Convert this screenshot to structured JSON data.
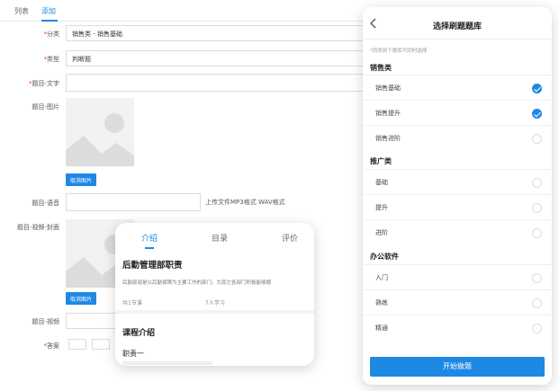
{
  "admin": {
    "tabs": [
      {
        "label": "列表"
      },
      {
        "label": "添加"
      }
    ],
    "fields": {
      "category": {
        "label": "分类",
        "value": "销售类 - 销售基础"
      },
      "type": {
        "label": "类型",
        "value": "判断题"
      },
      "text": {
        "label": "题目-文字",
        "value": ""
      },
      "image": {
        "label": "题目-图片",
        "button": "取消图片"
      },
      "audio": {
        "label": "题目-语音",
        "hint": "上传文件MP3格式 WAV格式"
      },
      "video_cover": {
        "label": "题目-视频-封面",
        "button": "取消图片"
      },
      "video": {
        "label": "题目-视频"
      },
      "answer": {
        "label": "答案"
      }
    }
  },
  "phone": {
    "title": "选择刷题题库",
    "back_icon": "chevron-left-icon",
    "note": "*同类别下题库可同时选择",
    "groups": [
      {
        "name": "销售类",
        "items": [
          {
            "label": "销售基础",
            "checked": true
          },
          {
            "label": "销售提升",
            "checked": true
          },
          {
            "label": "销售进阶",
            "checked": false
          }
        ]
      },
      {
        "name": "推广类",
        "items": [
          {
            "label": "基础",
            "checked": false
          },
          {
            "label": "提升",
            "checked": false
          },
          {
            "label": "进阶",
            "checked": false
          }
        ]
      },
      {
        "name": "办公软件",
        "items": [
          {
            "label": "入门",
            "checked": false
          },
          {
            "label": "熟练",
            "checked": false
          },
          {
            "label": "精通",
            "checked": false
          }
        ]
      }
    ],
    "start_button": "开始做题"
  },
  "course": {
    "tabs": [
      {
        "label": "介绍"
      },
      {
        "label": "目录"
      },
      {
        "label": "评价"
      }
    ],
    "title": "后勤管理部职责",
    "desc": "后勤部就是以后勤保障为主要工作的部门。为其它各部门积极能够顺",
    "lessons": "共1节课",
    "learners": "7人学习",
    "section_title": "课程介绍",
    "sub_title": "职责一"
  },
  "colors": {
    "accent": "#1e88e5",
    "required": "#e53935"
  }
}
